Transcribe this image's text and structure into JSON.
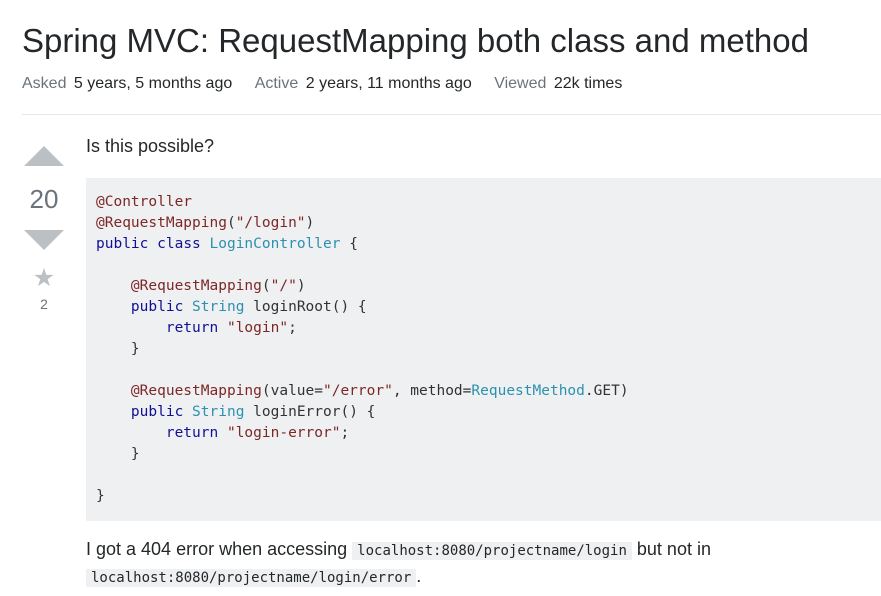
{
  "question": {
    "title": "Spring MVC: RequestMapping both class and method",
    "meta": {
      "asked_label": "Asked",
      "asked_value": "5 years, 5 months ago",
      "active_label": "Active",
      "active_value": "2 years, 11 months ago",
      "viewed_label": "Viewed",
      "viewed_value": "22k times"
    },
    "votes": "20",
    "favorites": "2",
    "intro": "Is this possible?",
    "code_lines": [
      "@Controller",
      "@RequestMapping(\"/login\")",
      "public class LoginController {",
      "",
      "    @RequestMapping(\"/\")",
      "    public String loginRoot() {",
      "        return \"login\";",
      "    }",
      "",
      "    @RequestMapping(value=\"/error\", method=RequestMethod.GET)",
      "    public String loginError() {",
      "        return \"login-error\";",
      "    }",
      "",
      "}"
    ],
    "outro": {
      "before": "I got a 404 error when accessing",
      "code1": "localhost:8080/projectname/login",
      "middle": "but not in",
      "code2": "localhost:8080/projectname/login/error",
      "after": "."
    }
  }
}
